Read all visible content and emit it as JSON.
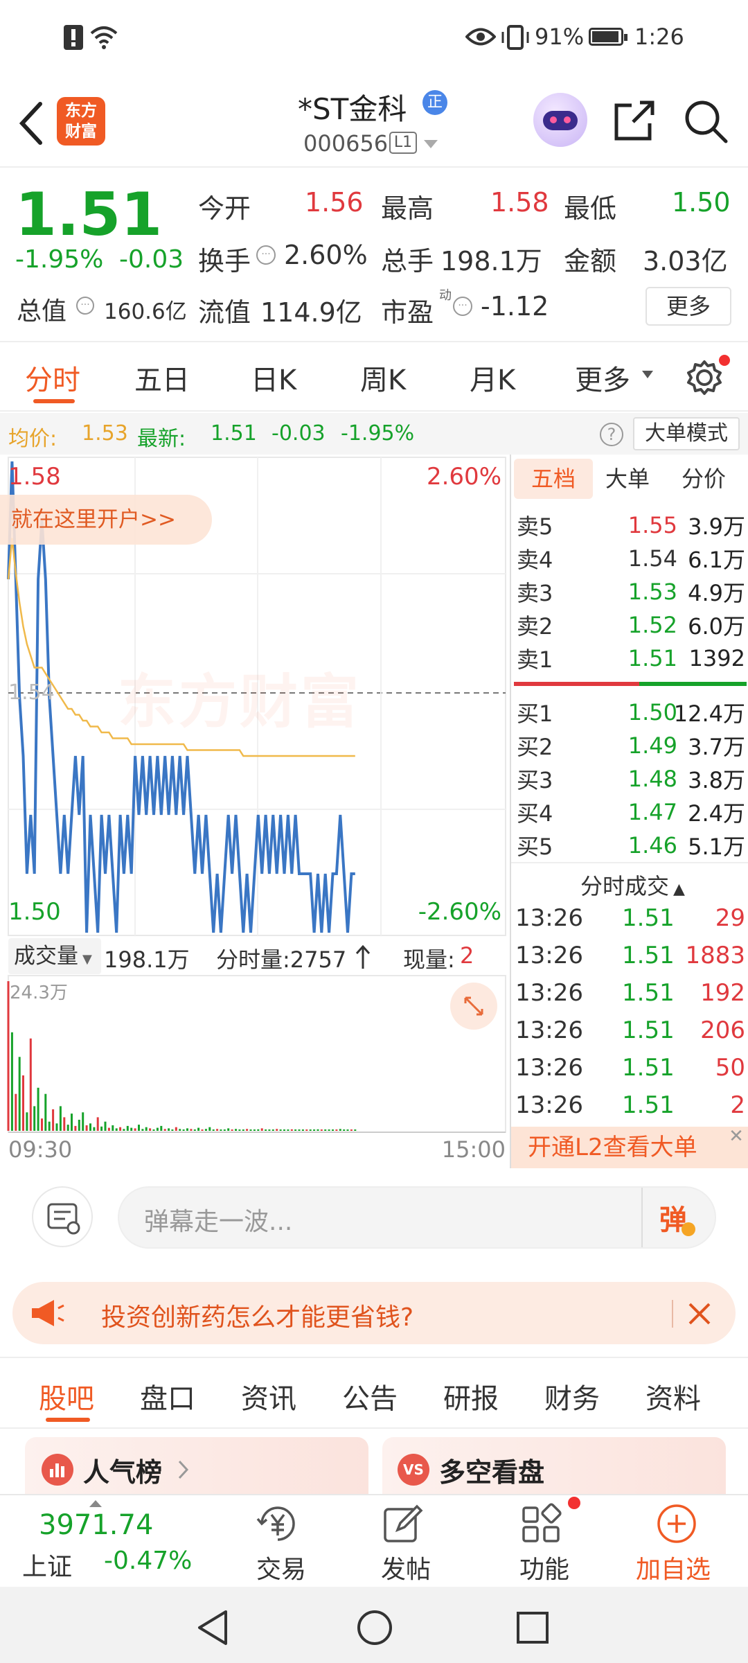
{
  "status": {
    "battery_pct": "91%",
    "time": "1:26"
  },
  "header": {
    "logo_line1": "东方",
    "logo_line2": "财富",
    "stock_name": "*ST金科",
    "name_badge": "正",
    "stock_code": "000656",
    "level_badge": "L1"
  },
  "quote": {
    "price": "1.51",
    "change_pct": "-1.95%",
    "change_amt": "-0.03",
    "open_label": "今开",
    "open_val": "1.56",
    "high_label": "最高",
    "high_val": "1.58",
    "low_label": "最低",
    "low_val": "1.50",
    "turnover_label": "换手",
    "turnover_val": "2.60%",
    "volume_label": "总手",
    "volume_val": "198.1万",
    "amount_label": "金额",
    "amount_val": "3.03亿",
    "mktcap_label": "总值",
    "mktcap_val": "160.6亿",
    "float_label": "流值",
    "float_val": "114.9亿",
    "pe_label": "市盈",
    "pe_sup": "动",
    "pe_val": "-1.12",
    "more_button": "更多"
  },
  "tabs": {
    "items": [
      "分时",
      "五日",
      "日K",
      "周K",
      "月K",
      "更多"
    ],
    "active": 0
  },
  "avgbar": {
    "avg_label": "均价:",
    "avg_val": "1.53",
    "latest_label": "最新:",
    "latest_val": "1.51",
    "latest_chg": "-0.03",
    "latest_pct": "-1.95%",
    "mode_button": "大单模式"
  },
  "chart": {
    "top_price": "1.58",
    "top_pct": "2.60%",
    "mid_price": "1.54",
    "bottom_price": "1.50",
    "bottom_pct": "-2.60%",
    "open_account_banner": "就在这里开户>>",
    "watermark": "东方财富",
    "vol_label": "成交量",
    "vol_total": "198.1万",
    "vol_tick_label": "分时量:2757",
    "vol_now_label": "现量:",
    "vol_now_val": "2",
    "vol_max": "24.3万",
    "time_start": "09:30",
    "time_end": "15:00",
    "colors": {
      "price_line": "#3a76c4",
      "avg_line": "#f0b94a",
      "up": "#e0393e",
      "down": "#16a22a"
    }
  },
  "chart_data": {
    "type": "line",
    "x_label_start": "09:30",
    "x_label_end": "15:00",
    "ylim": [
      1.5,
      1.58
    ],
    "reference_price": 1.54,
    "series": [
      {
        "values": [
          1.56,
          1.58,
          1.56,
          1.54,
          1.53,
          1.51,
          1.52,
          1.51,
          1.56,
          1.57,
          1.56,
          1.54,
          1.53,
          1.52,
          1.51,
          1.52,
          1.51,
          1.52,
          1.53,
          1.52,
          1.53,
          1.5,
          1.52,
          1.51,
          1.5,
          1.52,
          1.51,
          1.52,
          1.51,
          1.5,
          1.52,
          1.51,
          1.52,
          1.51,
          1.53,
          1.52,
          1.53,
          1.52,
          1.53,
          1.52,
          1.53,
          1.52,
          1.53,
          1.52,
          1.53,
          1.52,
          1.53,
          1.52,
          1.53,
          1.52,
          1.51,
          1.52,
          1.51,
          1.52,
          1.51,
          1.5,
          1.51,
          1.5,
          1.51,
          1.52,
          1.51,
          1.52,
          1.51,
          1.5,
          1.51,
          1.5,
          1.51,
          1.52,
          1.51,
          1.52,
          1.51,
          1.52,
          1.51,
          1.52,
          1.51,
          1.52,
          1.51,
          1.52,
          1.51,
          1.51,
          1.51,
          1.51,
          1.5,
          1.51,
          1.5,
          1.51,
          1.5,
          1.51,
          1.51,
          1.52,
          1.51,
          1.5,
          1.51,
          1.51
        ]
      },
      {
        "values": [
          1.56,
          1.567,
          1.561,
          1.556,
          1.552,
          1.549,
          1.547,
          1.545,
          1.545,
          1.545,
          1.544,
          1.543,
          1.542,
          1.541,
          1.54,
          1.539,
          1.538,
          1.538,
          1.537,
          1.537,
          1.536,
          1.536,
          1.535,
          1.535,
          1.535,
          1.534,
          1.534,
          1.534,
          1.533,
          1.533,
          1.533,
          1.533,
          1.533,
          1.532,
          1.532,
          1.532,
          1.532,
          1.532,
          1.532,
          1.532,
          1.532,
          1.532,
          1.532,
          1.532,
          1.532,
          1.532,
          1.532,
          1.532,
          1.531,
          1.531,
          1.531,
          1.531,
          1.531,
          1.531,
          1.531,
          1.531,
          1.531,
          1.531,
          1.531,
          1.531,
          1.531,
          1.531,
          1.531,
          1.53,
          1.53,
          1.53,
          1.53,
          1.53,
          1.53,
          1.53,
          1.53,
          1.53,
          1.53,
          1.53,
          1.53,
          1.53,
          1.53,
          1.53,
          1.53,
          1.53,
          1.53,
          1.53,
          1.53,
          1.53,
          1.53,
          1.53,
          1.53,
          1.53,
          1.53,
          1.53,
          1.53,
          1.53,
          1.53,
          1.53
        ]
      }
    ],
    "volume": {
      "max": 243000,
      "values": [
        243000,
        160000,
        60000,
        120000,
        90000,
        30000,
        150000,
        40000,
        70000,
        20000,
        60000,
        15000,
        35000,
        12000,
        40000,
        22000,
        10000,
        28000,
        8000,
        18000,
        30000,
        9000,
        12000,
        6000,
        22000,
        7000,
        15000,
        5000,
        9000,
        4000,
        6000,
        3000,
        8000,
        5000,
        4000,
        10000,
        3000,
        6000,
        4000,
        2000,
        5000,
        8000,
        3000,
        4000,
        2000,
        6000,
        3000,
        2000,
        4000,
        3000,
        2000,
        5000,
        2000,
        3000,
        6000,
        2000,
        3000,
        1500,
        2000,
        4000,
        2000,
        3000,
        2000,
        1500,
        3000,
        2000,
        1500,
        2500,
        4000,
        2000,
        1500,
        2000,
        3000,
        1500,
        2000,
        1000,
        2500,
        1500,
        2000,
        1000,
        1500,
        2000,
        1000,
        2500,
        1500,
        1000,
        2000,
        1000,
        1500,
        3000,
        1000,
        2000,
        1500,
        1000
      ],
      "colors_up": [
        0,
        2,
        4,
        6,
        9,
        12,
        15,
        18,
        21,
        24,
        27,
        30,
        34,
        38,
        42,
        45,
        49,
        52,
        56,
        60,
        64,
        68,
        72,
        76,
        80,
        84,
        88,
        92
      ]
    }
  },
  "orderbook": {
    "tabs": [
      "五档",
      "大单",
      "分价"
    ],
    "asks": [
      {
        "label": "卖5",
        "price": "1.55",
        "vol": "3.9万"
      },
      {
        "label": "卖4",
        "price": "1.54",
        "vol": "6.1万"
      },
      {
        "label": "卖3",
        "price": "1.53",
        "vol": "4.9万"
      },
      {
        "label": "卖2",
        "price": "1.52",
        "vol": "6.0万"
      },
      {
        "label": "卖1",
        "price": "1.51",
        "vol": "1392"
      }
    ],
    "bids": [
      {
        "label": "买1",
        "price": "1.50",
        "vol": "12.4万"
      },
      {
        "label": "买2",
        "price": "1.49",
        "vol": "3.7万"
      },
      {
        "label": "买3",
        "price": "1.48",
        "vol": "3.8万"
      },
      {
        "label": "买4",
        "price": "1.47",
        "vol": "2.4万"
      },
      {
        "label": "买5",
        "price": "1.46",
        "vol": "5.1万"
      }
    ],
    "trades_title": "分时成交",
    "trades": [
      {
        "time": "13:26",
        "price": "1.51",
        "vol": "29"
      },
      {
        "time": "13:26",
        "price": "1.51",
        "vol": "1883"
      },
      {
        "time": "13:26",
        "price": "1.51",
        "vol": "192"
      },
      {
        "time": "13:26",
        "price": "1.51",
        "vol": "206"
      },
      {
        "time": "13:26",
        "price": "1.51",
        "vol": "50"
      },
      {
        "time": "13:26",
        "price": "1.51",
        "vol": "2"
      }
    ],
    "l2_banner": "开通L2查看大单"
  },
  "danmu": {
    "placeholder": "弹幕走一波...",
    "send_label": "弹"
  },
  "notice": {
    "text": "投资创新药怎么才能更省钱?"
  },
  "subtabs": {
    "items": [
      "股吧",
      "盘口",
      "资讯",
      "公告",
      "研报",
      "财务",
      "资料"
    ],
    "active": 0
  },
  "cards": {
    "left_title": "人气榜",
    "right_badge": "VS",
    "right_title": "多空看盘"
  },
  "bottomnav": {
    "index_val": "3971.74",
    "index_name": "上证",
    "index_pct": "-0.47%",
    "trade": "交易",
    "post": "发帖",
    "func": "功能",
    "add": "加自选"
  }
}
